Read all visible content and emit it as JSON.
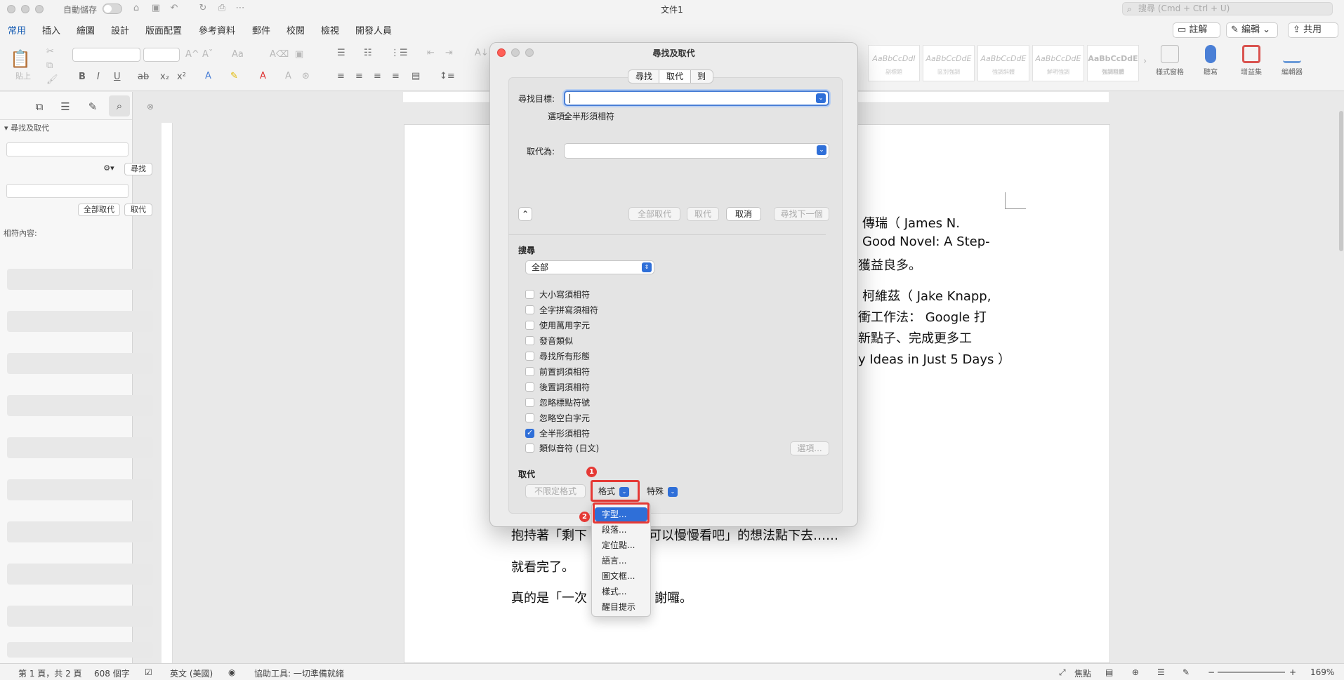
{
  "titlebar": {
    "autosave_label": "自動儲存",
    "doc_title": "文件1",
    "search_placeholder": "搜尋 (Cmd + Ctrl + U)"
  },
  "ribbon": {
    "tabs": [
      "常用",
      "插入",
      "繪圖",
      "設計",
      "版面配置",
      "參考資料",
      "郵件",
      "校閱",
      "檢視",
      "開發人員"
    ],
    "comments_label": "註解",
    "edit_label": "編輯",
    "share_label": "共用",
    "paste_label": "貼上",
    "styles": [
      {
        "sample": "AaBbCcDdI",
        "name": "副標題"
      },
      {
        "sample": "AaBbCcDdE",
        "name": "區別強調"
      },
      {
        "sample": "AaBbCcDdE",
        "name": "強調斜體"
      },
      {
        "sample": "AaBbCcDdE",
        "name": "鮮明強調"
      },
      {
        "sample": "AaBbCcDdE",
        "name": "強調粗體"
      }
    ],
    "style_pane_label": "樣式窗格",
    "dictate_label": "聽寫",
    "addins_label": "增益集",
    "editor_label": "編輯器"
  },
  "sidebar": {
    "title": "尋找及取代",
    "find_button": "尋找",
    "replace_all_button": "全部取代",
    "replace_button": "取代",
    "results_label": "相符內容:"
  },
  "document": {
    "lines": [
      "傳瑞（ James N.",
      "Good Novel: A Step-",
      "獲益良多。",
      "柯維茲（ Jake Knapp,",
      "衝工作法： Google 打",
      "新點子、完成更多工",
      "y Ideas in Just 5 Days ）",
      "抱持著「剩下",
      "可以慢慢看吧」的想法點下去……",
      "就看完了。",
      "真的是「一次",
      "謝囉。"
    ]
  },
  "dialog": {
    "title": "尋找及取代",
    "tabs": [
      "尋找",
      "取代",
      "到"
    ],
    "find_label": "尋找目標:",
    "options_label": "選項:",
    "options_value": "全半形須相符",
    "replace_label": "取代為:",
    "buttons": {
      "replace_all": "全部取代",
      "replace": "取代",
      "cancel": "取消",
      "find_next": "尋找下一個"
    },
    "search_section": "搜尋",
    "search_scope": "全部",
    "checkboxes": [
      {
        "label": "大小寫須相符",
        "checked": false
      },
      {
        "label": "全字拼寫須相符",
        "checked": false
      },
      {
        "label": "使用萬用字元",
        "checked": false
      },
      {
        "label": "發音類似",
        "checked": false
      },
      {
        "label": "尋找所有形態",
        "checked": false
      },
      {
        "label": "前置詞須相符",
        "checked": false
      },
      {
        "label": "後置詞須相符",
        "checked": false
      },
      {
        "label": "忽略標點符號",
        "checked": false
      },
      {
        "label": "忽略空白字元",
        "checked": false
      },
      {
        "label": "全半形須相符",
        "checked": true
      },
      {
        "label": "類似音符 (日文)",
        "checked": false
      }
    ],
    "options_button": "選項...",
    "replace_section": "取代",
    "no_format_button": "不限定格式",
    "format_menu": "格式",
    "special_menu": "特殊",
    "badge_1": "1",
    "badge_2": "2"
  },
  "format_menu_items": [
    "字型...",
    "段落...",
    "定位點...",
    "語言...",
    "圖文框...",
    "樣式...",
    "醒目提示"
  ],
  "statusbar": {
    "page": "第 1 頁，共 2 頁",
    "words": "608 個字",
    "language": "英文 (美國)",
    "accessibility": "協助工具: 一切準備就緒",
    "focus": "焦點",
    "zoom": "169%"
  },
  "colors": {
    "accent": "#2f6fd8",
    "highlight_red": "#e53935",
    "tab_active": "#1a5fb4"
  }
}
